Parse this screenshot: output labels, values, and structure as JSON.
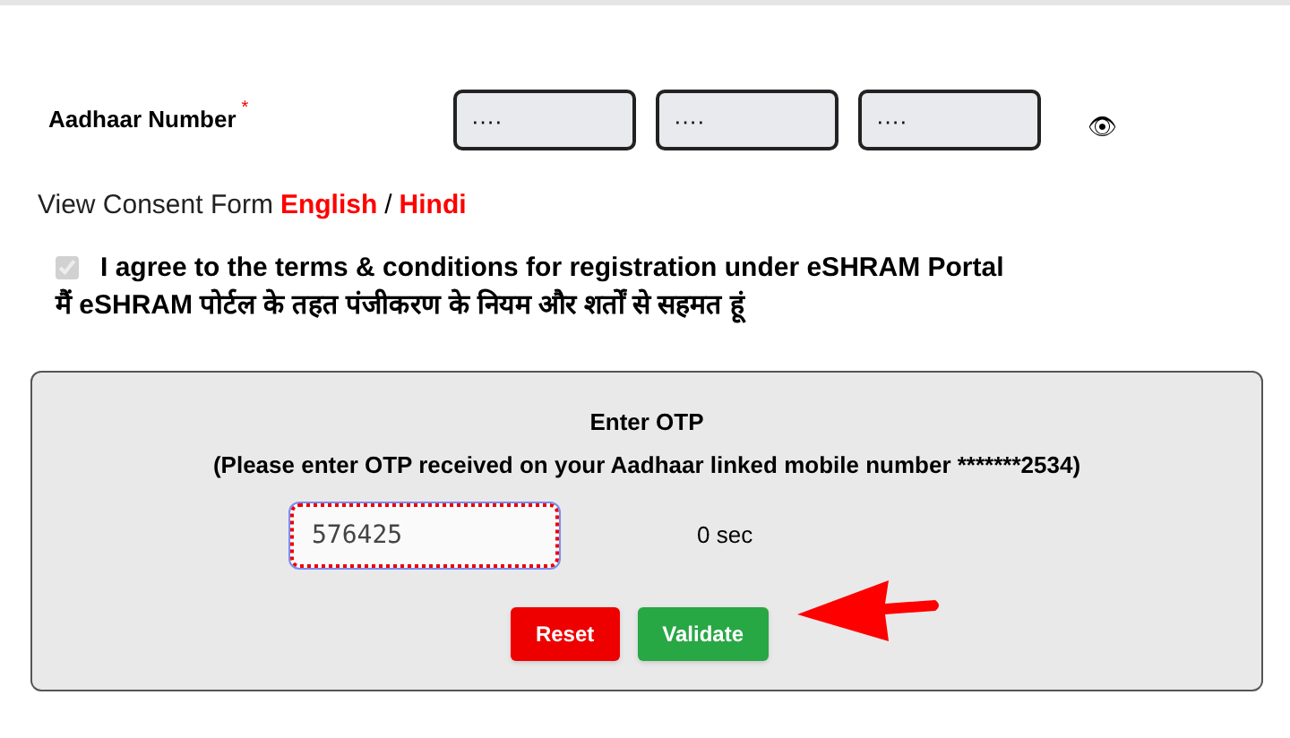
{
  "aadhaar": {
    "label": "Aadhaar Number",
    "required_mark": "*",
    "fields": [
      {
        "value": "····"
      },
      {
        "value": "····"
      },
      {
        "value": "····"
      }
    ],
    "show_toggle": "👁"
  },
  "consent": {
    "prefix": "View Consent Form",
    "links": [
      "English",
      "Hindi"
    ],
    "separator": "/"
  },
  "agreement": {
    "checked": true,
    "disabled": true,
    "text": "I agree to the terms & conditions for registration under eSHRAM Portal",
    "text_hindi": "मैं eSHRAM पोर्टल के तहत पंजीकरण के नियम और शर्तों से सहमत हूं"
  },
  "otp": {
    "title": "Enter OTP",
    "instructions": "(Please enter OTP received on your Aadhaar linked mobile number *******2534)",
    "value": "576425",
    "timer": "0 sec",
    "buttons": [
      {
        "kind": "reset",
        "label": "Reset"
      },
      {
        "kind": "validate",
        "label": "Validate"
      }
    ]
  }
}
